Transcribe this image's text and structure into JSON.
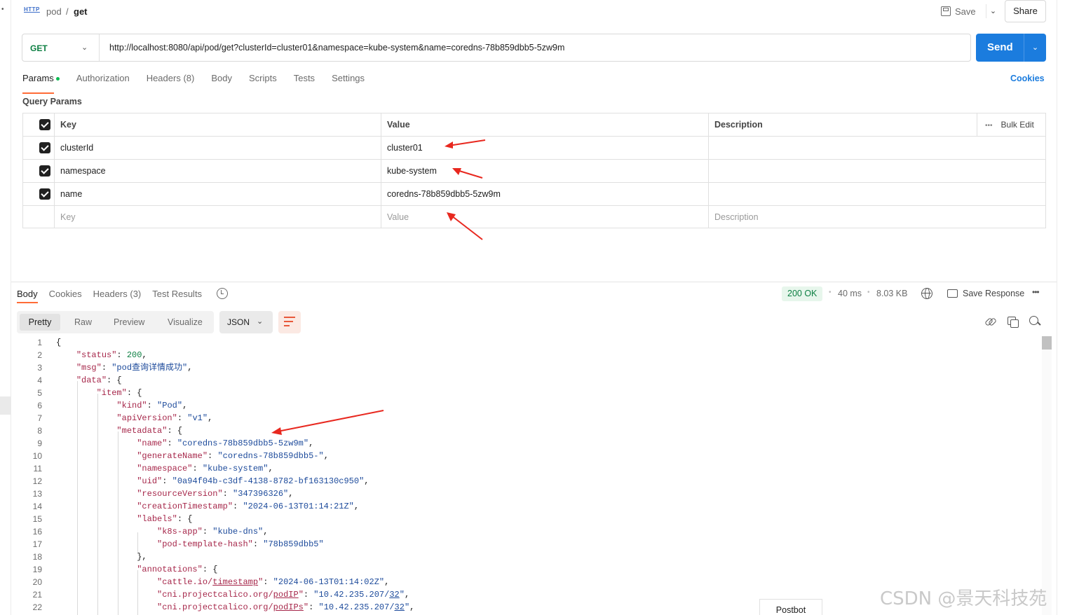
{
  "breadcrumb": {
    "icon": "HTTP",
    "parent": "pod",
    "separator": "/",
    "current": "get"
  },
  "header": {
    "save_label": "Save",
    "share_label": "Share"
  },
  "request": {
    "method": "GET",
    "url": "http://localhost:8080/api/pod/get?clusterId=cluster01&namespace=kube-system&name=coredns-78b859dbb5-5zw9m",
    "send_label": "Send"
  },
  "req_tabs": {
    "params": "Params",
    "authorization": "Authorization",
    "headers": "Headers",
    "headers_count": "(8)",
    "body": "Body",
    "scripts": "Scripts",
    "tests": "Tests",
    "settings": "Settings",
    "cookies": "Cookies"
  },
  "query_params": {
    "title": "Query Params",
    "headers": {
      "key": "Key",
      "value": "Value",
      "description": "Description",
      "bulk_edit": "Bulk Edit"
    },
    "rows": [
      {
        "key": "clusterId",
        "value": "cluster01"
      },
      {
        "key": "namespace",
        "value": "kube-system"
      },
      {
        "key": "name",
        "value": "coredns-78b859dbb5-5zw9m"
      }
    ],
    "placeholders": {
      "key": "Key",
      "value": "Value",
      "description": "Description"
    }
  },
  "response": {
    "tabs": {
      "body": "Body",
      "cookies": "Cookies",
      "headers": "Headers (3)",
      "test_results": "Test Results"
    },
    "status": "200 OK",
    "time": "40 ms",
    "size": "8.03 KB",
    "save_response": "Save Response",
    "views": [
      "Pretty",
      "Raw",
      "Preview",
      "Visualize"
    ],
    "format": "JSON"
  },
  "code_lines": [
    "1",
    "2",
    "3",
    "4",
    "5",
    "6",
    "7",
    "8",
    "9",
    "10",
    "11",
    "12",
    "13",
    "14",
    "15",
    "16",
    "17",
    "18",
    "19",
    "20",
    "21",
    "22"
  ],
  "json": {
    "status_key": "\"status\"",
    "status_val": "200",
    "msg_key": "\"msg\"",
    "msg_val": "\"pod查询详情成功\"",
    "data_key": "\"data\"",
    "item_key": "\"item\"",
    "kind_key": "\"kind\"",
    "kind_val": "\"Pod\"",
    "apiversion_key": "\"apiVersion\"",
    "apiversion_val": "\"v1\"",
    "metadata_key": "\"metadata\"",
    "name_key": "\"name\"",
    "name_val": "\"coredns-78b859dbb5-5zw9m\"",
    "generatename_key": "\"generateName\"",
    "generatename_val": "\"coredns-78b859dbb5-\"",
    "namespace_key": "\"namespace\"",
    "namespace_val": "\"kube-system\"",
    "uid_key": "\"uid\"",
    "uid_val": "\"0a94f04b-c3df-4138-8782-bf163130c950\"",
    "resourceversion_key": "\"resourceVersion\"",
    "resourceversion_val": "\"347396326\"",
    "creationtimestamp_key": "\"creationTimestamp\"",
    "creationtimestamp_val": "\"2024-06-13T01:14:21Z\"",
    "labels_key": "\"labels\"",
    "k8sapp_key": "\"k8s-app\"",
    "k8sapp_val": "\"kube-dns\"",
    "podtemplatehash_key": "\"pod-template-hash\"",
    "podtemplatehash_val": "\"78b859dbb5\"",
    "annotations_key": "\"annotations\"",
    "cattle_key_a": "\"cattle.io/",
    "cattle_key_b": "timestamp",
    "cattle_key_c": "\"",
    "cattle_val": "\"2024-06-13T01:14:02Z\"",
    "podip_key_a": "\"cni.projectcalico.org/",
    "podip_key_b": "podIP",
    "podip_key_c": "\"",
    "podip_val_a": "\"10.42.235.207/",
    "podip_val_b": "32",
    "podip_val_c": "\"",
    "podips_key_a": "\"cni.projectcalico.org/",
    "podips_key_b": "podIPs",
    "podips_key_c": "\"",
    "podips_val_a": "\"10.42.235.207/",
    "podips_val_b": "32",
    "podips_val_c": "\""
  },
  "postbot": "Postbot",
  "watermark": "CSDN @景天科技苑",
  "colors": {
    "accent": "#ff6c37",
    "send": "#1b7cde",
    "method": "#0c7f42",
    "annotation_arrow": "#e8281f"
  },
  "icons": [
    "http-icon",
    "save-icon",
    "chevron-down-icon",
    "checkbox-checked-icon",
    "more-icon",
    "history-icon",
    "globe-icon",
    "save-response-icon",
    "wrap-lines-icon",
    "link-icon",
    "copy-icon",
    "search-icon"
  ]
}
